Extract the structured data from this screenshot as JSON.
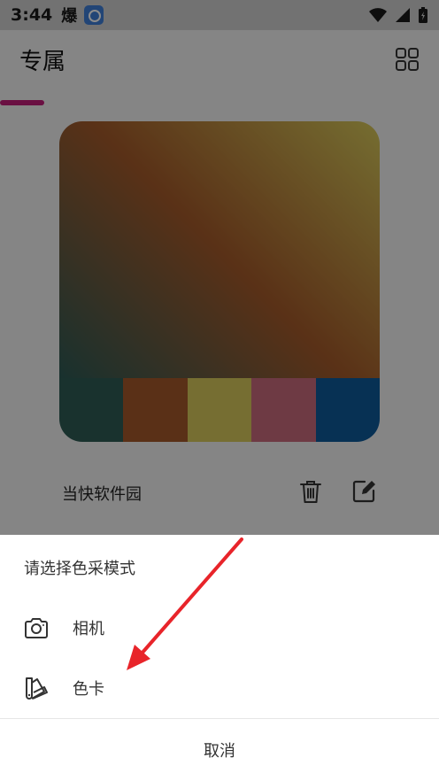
{
  "status_bar": {
    "time": "3:44",
    "glyph": "爆"
  },
  "header": {
    "title": "专属"
  },
  "card": {
    "name": "当快软件园",
    "swatches": [
      "#2e5b54",
      "#a4582a",
      "#d8c85c",
      "#c86b7c",
      "#0e5a9a"
    ]
  },
  "sheet": {
    "title": "请选择色采模式",
    "options": [
      {
        "label": "相机",
        "icon": "camera-icon"
      },
      {
        "label": "色卡",
        "icon": "color-palette-icon"
      }
    ],
    "cancel_label": "取消"
  },
  "colors": {
    "accent_underline": "#c21e78",
    "annotation_arrow": "#e8242a"
  }
}
